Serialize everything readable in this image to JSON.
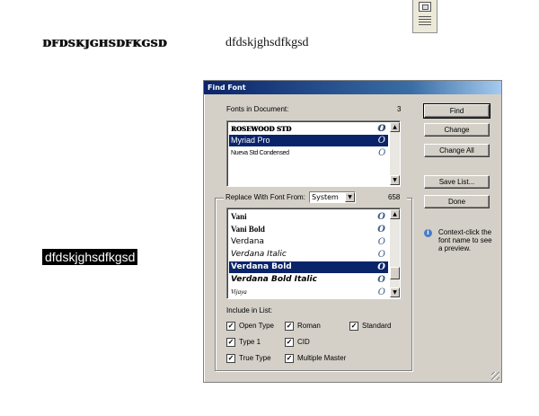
{
  "samples": {
    "decorative": "DFDSKJGHSDFKGSD",
    "serif": "dfdskjghsdfkgsd",
    "highlighted": "dfdskjghsdfkgsd"
  },
  "dialog": {
    "title": "Find Font",
    "fonts_in_document_label": "Fonts in Document:",
    "fonts_in_document_count": "3",
    "document_fonts": [
      {
        "name": "ROSEWOOD STD",
        "selected": false
      },
      {
        "name": "Myriad Pro",
        "selected": true
      },
      {
        "name": "Nueva Std Condensed",
        "selected": false
      }
    ],
    "buttons": {
      "find": "Find",
      "change": "Change",
      "change_all": "Change All",
      "save_list": "Save List...",
      "done": "Done"
    },
    "replace_label": "Replace With Font From:",
    "replace_source": "System",
    "replace_count": "658",
    "system_fonts": [
      {
        "name": "Vani",
        "selected": false
      },
      {
        "name": "Vani Bold",
        "selected": false
      },
      {
        "name": "Verdana",
        "selected": false
      },
      {
        "name": "Verdana Italic",
        "selected": false
      },
      {
        "name": "Verdana Bold",
        "selected": true
      },
      {
        "name": "Verdana Bold Italic",
        "selected": false
      },
      {
        "name": "Vijaya",
        "selected": false
      }
    ],
    "font_type_glyph": "O",
    "info_text": "Context-click the font name to see a preview.",
    "include_label": "Include in List:",
    "include_options": {
      "open_type": {
        "label": "Open Type",
        "checked": true
      },
      "roman": {
        "label": "Roman",
        "checked": true
      },
      "standard": {
        "label": "Standard",
        "checked": true
      },
      "type1": {
        "label": "Type 1",
        "checked": true
      },
      "cid": {
        "label": "CID",
        "checked": true
      },
      "true_type": {
        "label": "True Type",
        "checked": true
      },
      "multiple_master": {
        "label": "Multiple Master",
        "checked": true
      }
    },
    "check_glyph": "✓"
  },
  "icons": {
    "scroll_up": "▲",
    "scroll_down": "▼",
    "dropdown": "▼",
    "info": "i"
  }
}
